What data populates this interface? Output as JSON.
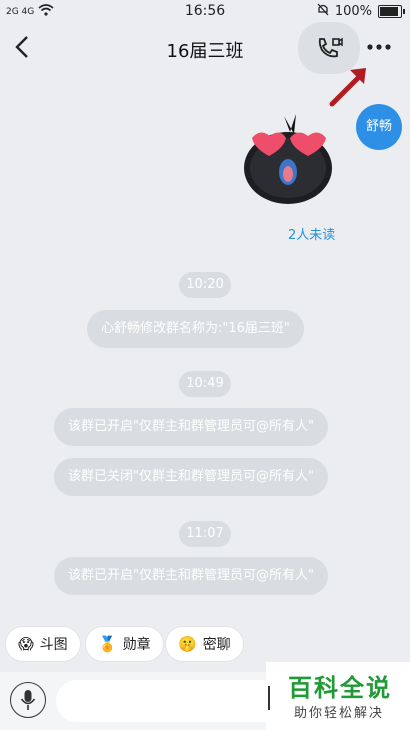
{
  "status": {
    "signal_left": "2G 4G",
    "time": "16:56",
    "battery": "100%",
    "battery_level": 1.0
  },
  "header": {
    "title": "16届三班"
  },
  "chat": {
    "sender_name": "舒畅",
    "read_status": "2人未读",
    "events": [
      {
        "time": "10:20",
        "message": "心舒畅修改群名称为:\"16届三班\""
      },
      {
        "time": "10:49",
        "message": "该群已开启\"仅群主和群管理员可@所有人\""
      },
      {
        "message": "该群已关闭\"仅群主和群管理员可@所有人\""
      },
      {
        "time": "11:07",
        "message": "该群已开启\"仅群主和群管理员可@所有人\""
      }
    ]
  },
  "quick": [
    {
      "label": "斗图",
      "icon": "sticker-icon"
    },
    {
      "label": "勋章",
      "icon": "medal-icon"
    },
    {
      "label": "密聊",
      "icon": "secret-chat-icon"
    }
  ],
  "watermark": {
    "title": "百科全说",
    "subtitle": "助你轻松解决"
  },
  "colors": {
    "accent": "#2d8fe6",
    "pill": "#d9dce1",
    "watermark_green": "#1f9a34",
    "arrow": "#b01c22"
  }
}
